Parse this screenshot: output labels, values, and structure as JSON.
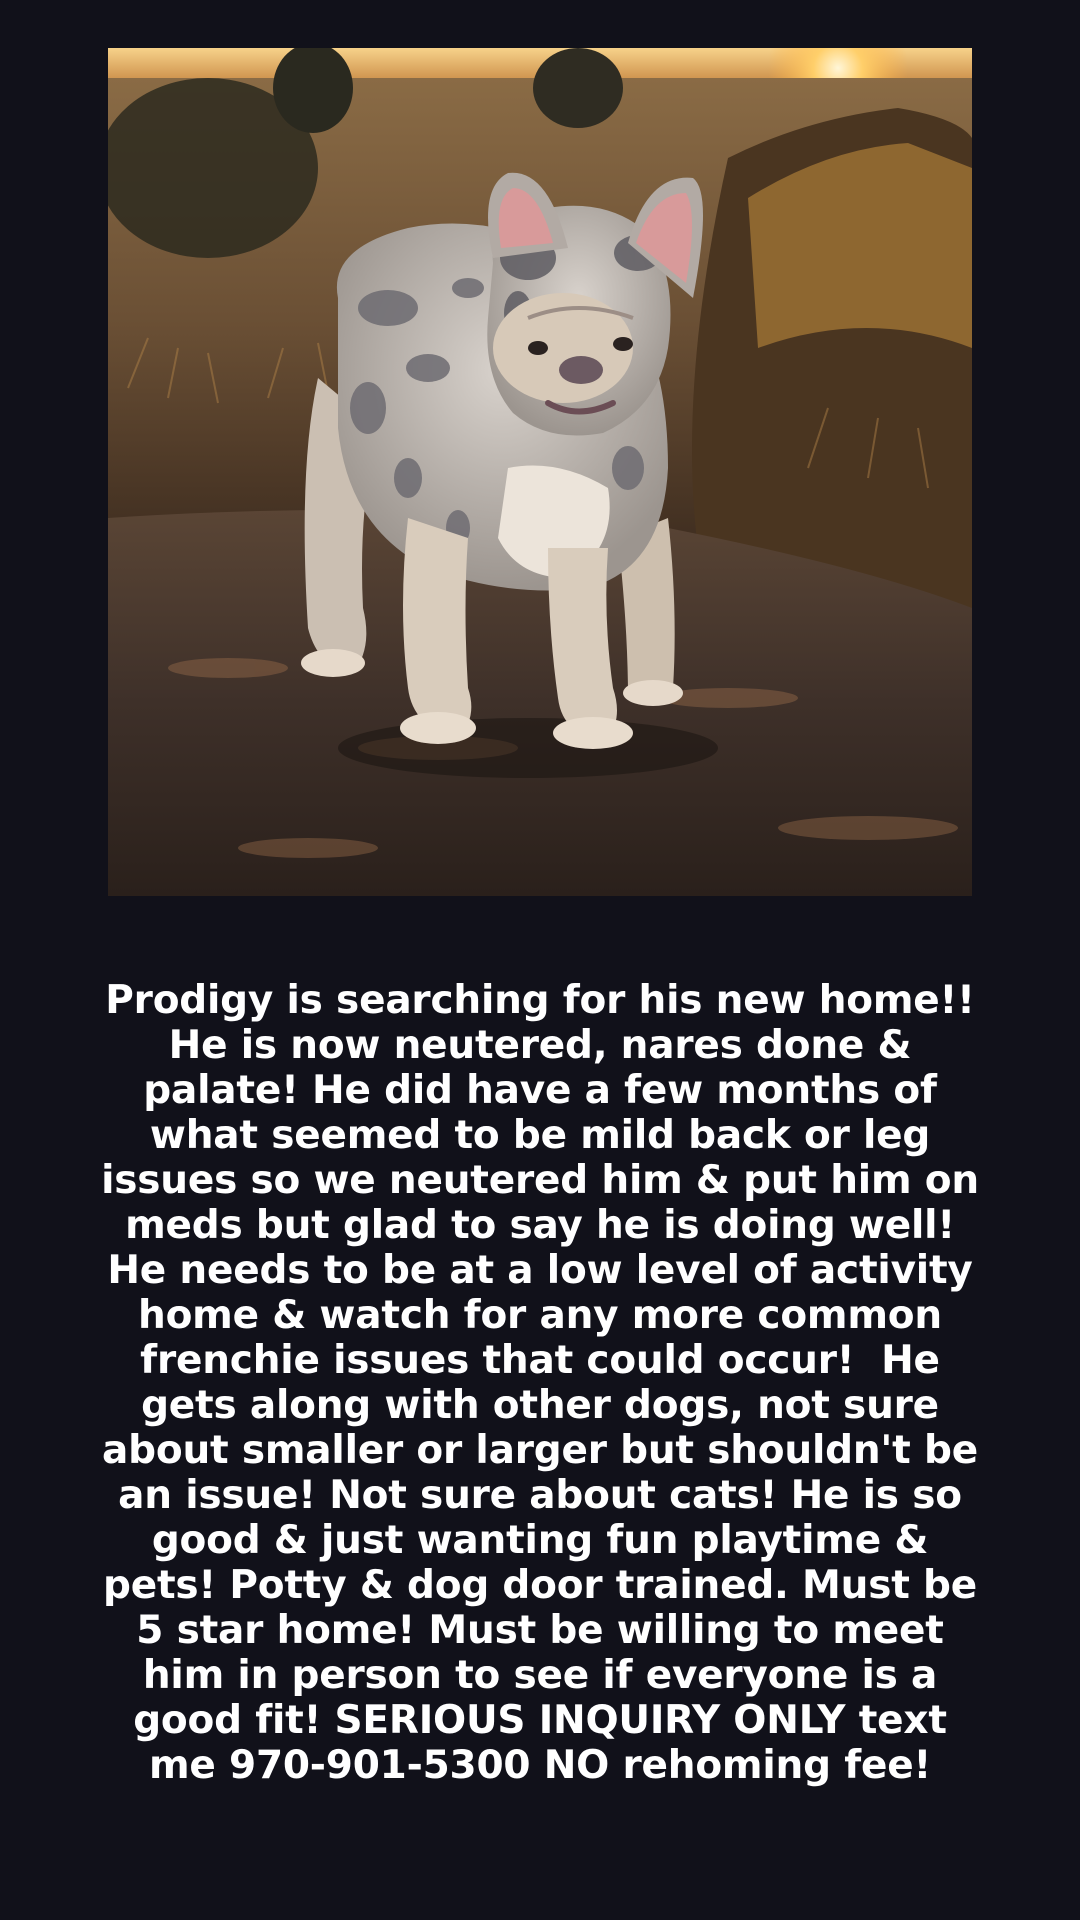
{
  "post": {
    "photo": {
      "icon": "dog-photo",
      "subject": "merle-french-bulldog"
    },
    "caption": "Prodigy is searching for his new home!! He is now neutered, nares done & palate! He did have a few months of what seemed to be mild back or leg issues so we neutered him & put him on meds but glad to say he is doing well! He needs to be at a low level of activity home & watch for any more common frenchie issues that could occur!  He gets along with other dogs, not sure about smaller or larger but shouldn't be an issue! Not sure about cats! He is so good & just wanting fun playtime & pets! Potty & dog door trained. Must be 5 star home! Must be willing to meet him in person to see if everyone is a good fit! SERIOUS INQUIRY ONLY text me 970-901-5300 NO rehoming fee!"
  },
  "colors": {
    "background": "#11111a",
    "text": "#ffffff",
    "sunset": "#f4a640",
    "ground": "#3a2e26"
  }
}
